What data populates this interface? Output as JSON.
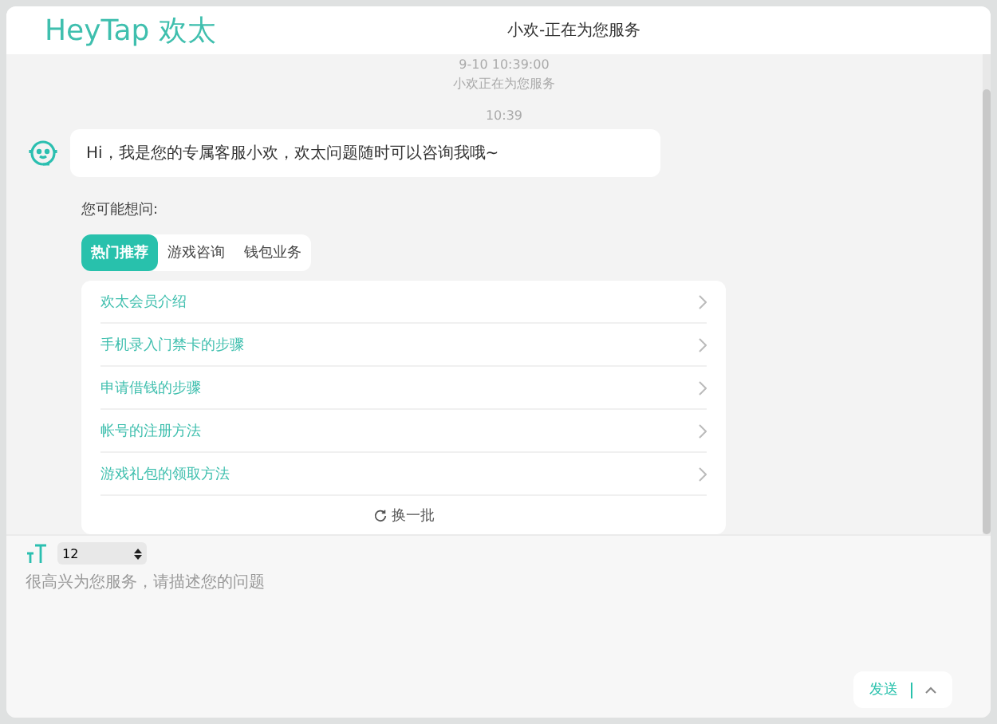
{
  "header": {
    "logo": "HeyTap 欢太",
    "title": "小欢-正在为您服务"
  },
  "chat": {
    "timestamp": "9-10 10:39:00",
    "status": "小欢正在为您服务",
    "time": "10:39",
    "message": "Hi，我是您的专属客服小欢，欢太问题随时可以咨询我哦~",
    "prompt": "您可能想问:",
    "tabs": [
      {
        "label": "热门推荐",
        "selected": true
      },
      {
        "label": "游戏咨询",
        "selected": false
      },
      {
        "label": "钱包业务",
        "selected": false
      }
    ],
    "questions": [
      "欢太会员介绍",
      "手机录入门禁卡的步骤",
      "申请借钱的步骤",
      "帐号的注册方法",
      "游戏礼包的领取方法"
    ],
    "refresh": "换一批"
  },
  "composer": {
    "font_size": "12",
    "placeholder": "很高兴为您服务，请描述您的问题",
    "send": "发送"
  }
}
